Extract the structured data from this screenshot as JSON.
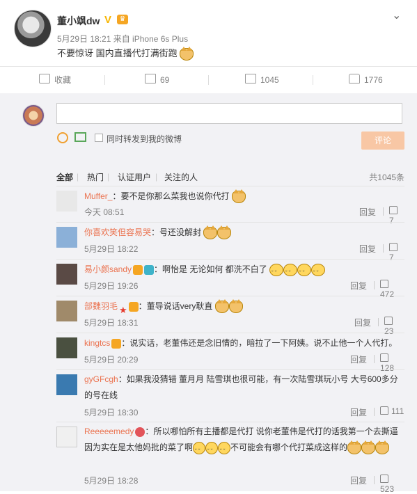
{
  "post": {
    "username": "董小飒dw",
    "meta": "5月29日 18:21 来自 iPhone 6s Plus",
    "text": "不要惊讶 国内直播代打满街跑"
  },
  "actions": {
    "favorite": "收藏",
    "repost_count": "69",
    "comment_count": "1045",
    "like_count": "1776"
  },
  "composer": {
    "placeholder": "",
    "repost_option": "同时转发到我的微博",
    "submit": "评论"
  },
  "filters": {
    "all": "全部",
    "hot": "热门",
    "verified": "认证用户",
    "following": "关注的人",
    "total": "共1045条"
  },
  "comments": [
    {
      "name": "Muffer_",
      "text": "：要不是你那么菜我也说你代打",
      "time": "今天 08:51",
      "reply": "回复",
      "likes": "7"
    },
    {
      "name": "你喜欢笑但容易哭",
      "text": "：号还没解封",
      "time": "5月29日 18:22",
      "reply": "回复",
      "likes": "7"
    },
    {
      "name": "易小颜sandy",
      "text": "：啊怡是 无论如何 都洗不白了",
      "time": "5月29日 19:26",
      "reply": "回复",
      "likes": "472"
    },
    {
      "name": "部魏羽毛",
      "text": "：董导说话very耿直",
      "time": "5月29日 18:31",
      "reply": "回复",
      "likes": "23"
    },
    {
      "name": "kingtcs",
      "text": "：说实话，老董伟还是念旧情的，暗拉了一下阿姨。说不止他一个人代打。",
      "time": "5月29日 20:29",
      "reply": "回复",
      "likes": "128"
    },
    {
      "name": "gyGFcgh",
      "text": "：如果我没猜错 董月月 陆雪琪也很可能，有一次陆雪琪玩小号 大号600多分的号在线",
      "time": "5月29日 18:30",
      "reply": "回复",
      "likes": "111"
    },
    {
      "name": "Reeeeemedy",
      "text": "：所以哪怕所有主播都是代打 说你老董伟是代打的话我第一个去撕逼  因为实在是太他妈批的菜了啊",
      "text2": "不可能会有哪个代打菜成这样的",
      "time": "5月29日 18:28",
      "reply": "回复",
      "likes": "523"
    }
  ],
  "colors": {
    "name": "#eb7350",
    "submit": "#f8c7a5",
    "verified_v": "#f7b500"
  }
}
